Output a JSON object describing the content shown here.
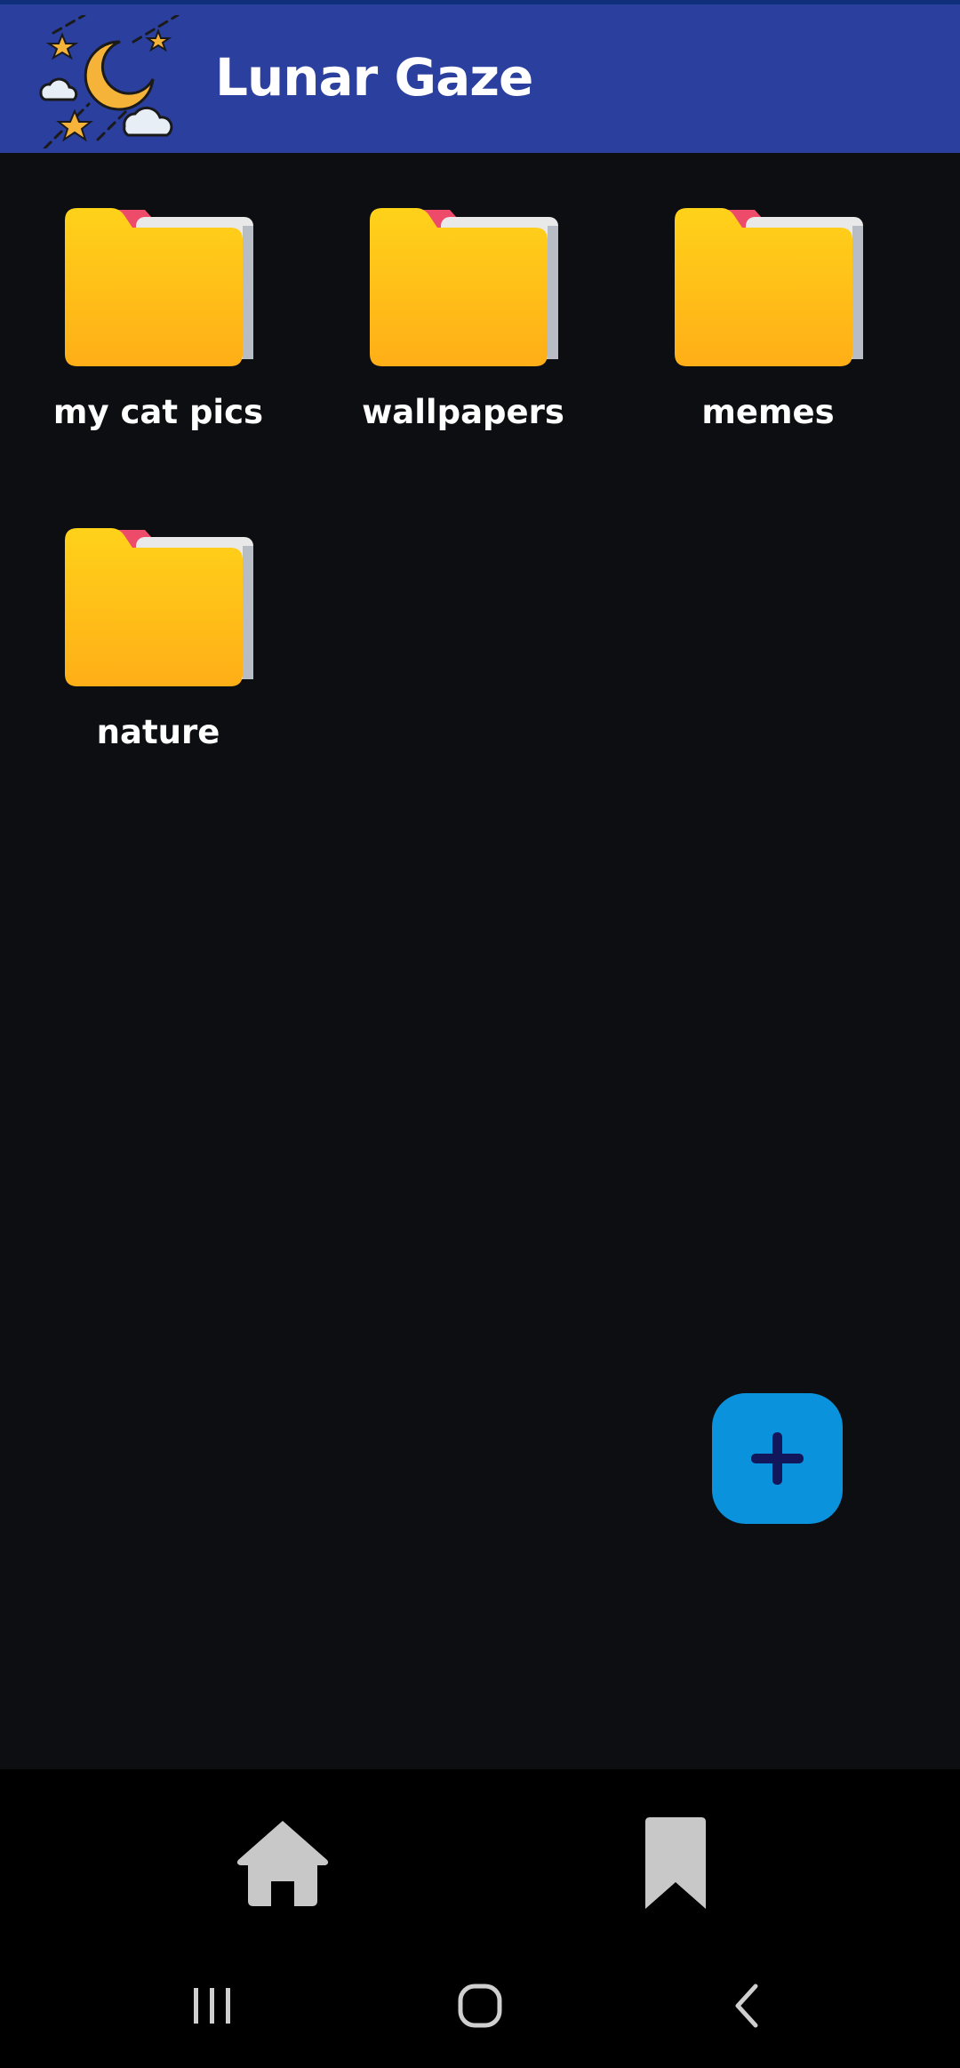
{
  "app": {
    "title": "Lunar Gaze",
    "logo_icon": "moon-stars-clouds-icon"
  },
  "colors": {
    "app_bar": "#2a3f9e",
    "background": "#0c0e11",
    "folder_yellow": "#ffcc1a",
    "folder_tab": "#ee4a6a",
    "fab": "#0a93dc",
    "fab_icon": "#12165a",
    "nav_icon": "#c8c8c8"
  },
  "folders": [
    {
      "label": "my cat pics",
      "icon": "folder-icon"
    },
    {
      "label": "wallpapers",
      "icon": "folder-icon"
    },
    {
      "label": "memes",
      "icon": "folder-icon"
    },
    {
      "label": "nature",
      "icon": "folder-icon"
    }
  ],
  "fab": {
    "icon": "plus-icon"
  },
  "bottom_nav": [
    {
      "icon": "home-icon"
    },
    {
      "icon": "bookmark-icon"
    }
  ],
  "system_nav": [
    {
      "icon": "recent-apps-icon"
    },
    {
      "icon": "home-circle-icon"
    },
    {
      "icon": "back-icon"
    }
  ]
}
